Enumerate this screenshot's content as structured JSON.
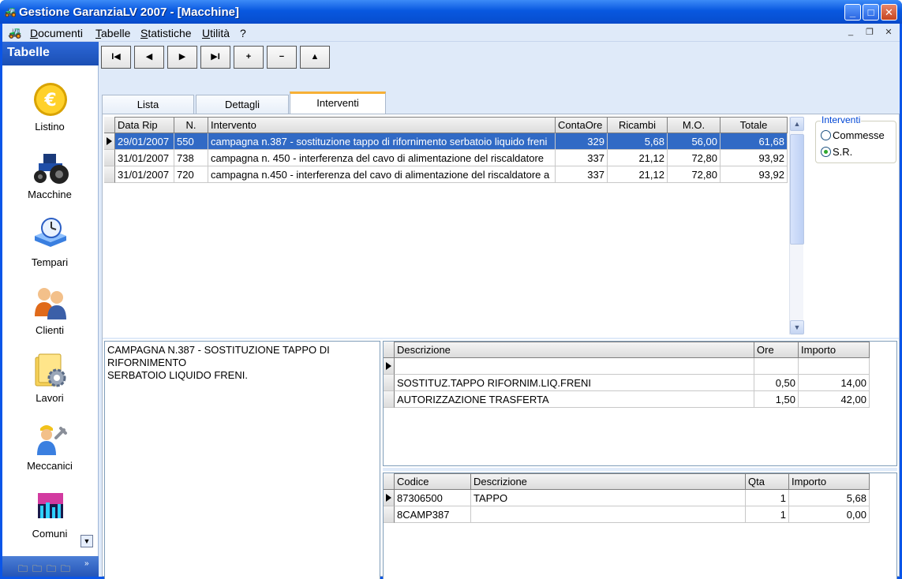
{
  "window": {
    "title": "Gestione GaranziaLV 2007 - [Macchine]",
    "min_glyph": "_",
    "max_glyph": "□",
    "close_glyph": "✕"
  },
  "menu": {
    "items": [
      {
        "first": "D",
        "rest": "ocumenti"
      },
      {
        "first": "T",
        "rest": "abelle"
      },
      {
        "first": "S",
        "rest": "tatistiche"
      },
      {
        "first": "U",
        "rest": "tilità"
      },
      {
        "first": "",
        "rest": "?"
      }
    ],
    "mdi_min": "_",
    "mdi_restore": "❐",
    "mdi_close": "✕"
  },
  "sidebar": {
    "header": "Tabelle",
    "items": [
      {
        "label": "Listino",
        "icon": "euro-coin-icon"
      },
      {
        "label": "Macchine",
        "icon": "tractor-icon"
      },
      {
        "label": "Tempari",
        "icon": "clock-book-icon"
      },
      {
        "label": "Clienti",
        "icon": "people-icon"
      },
      {
        "label": "Lavori",
        "icon": "gear-folder-icon"
      },
      {
        "label": "Meccanici",
        "icon": "mechanic-icon"
      },
      {
        "label": "Comuni",
        "icon": "city-icon"
      }
    ]
  },
  "toolbar": {
    "first": "I◀",
    "prev": "◀",
    "next": "▶",
    "last": "▶I",
    "add": "+",
    "remove": "−",
    "up": "▲"
  },
  "tabs": [
    {
      "label": "Lista",
      "active": false
    },
    {
      "label": "Dettagli",
      "active": false
    },
    {
      "label": "Interventi",
      "active": true
    }
  ],
  "interventi_grid": {
    "headers": [
      "Data Rip",
      "N.",
      "Intervento",
      "ContaOre",
      "Ricambi",
      "M.O.",
      "Totale"
    ],
    "rows": [
      [
        "29/01/2007",
        "550",
        "campagna n.387 - sostituzione tappo di rifornimento  serbatoio liquido freni",
        "329",
        "5,68",
        "56,00",
        "61,68"
      ],
      [
        "31/01/2007",
        "738",
        "campagna n. 450 - interferenza del cavo di alimentazione   del riscaldatore",
        "337",
        "21,12",
        "72,80",
        "93,92"
      ],
      [
        "31/01/2007",
        "720",
        "campagna n.450 - interferenza del cavo di alimentazione  del riscaldatore a",
        "337",
        "21,12",
        "72,80",
        "93,92"
      ]
    ]
  },
  "filter": {
    "legend": "Interventi",
    "options": [
      {
        "label": "Commesse",
        "checked": false
      },
      {
        "label": "S.R.",
        "checked": true
      }
    ]
  },
  "memo": {
    "text": "CAMPAGNA N.387 - SOSTITUZIONE TAPPO DI RIFORNIMENTO\nSERBATOIO LIQUIDO FRENI."
  },
  "lavori_grid": {
    "headers": [
      "Descrizione",
      "Ore",
      "Importo"
    ],
    "rows": [
      [
        "",
        "",
        ""
      ],
      [
        "SOSTITUZ.TAPPO RIFORNIM.LIQ.FRENI",
        "0,50",
        "14,00"
      ],
      [
        "AUTORIZZAZIONE TRASFERTA",
        "1,50",
        "42,00"
      ]
    ]
  },
  "ricambi_grid": {
    "headers": [
      "Codice",
      "Descrizione",
      "Qta",
      "Importo"
    ],
    "rows": [
      [
        "87306500",
        "TAPPO",
        "1",
        "5,68"
      ],
      [
        "8CAMP387",
        "",
        "1",
        "0,00"
      ]
    ]
  }
}
